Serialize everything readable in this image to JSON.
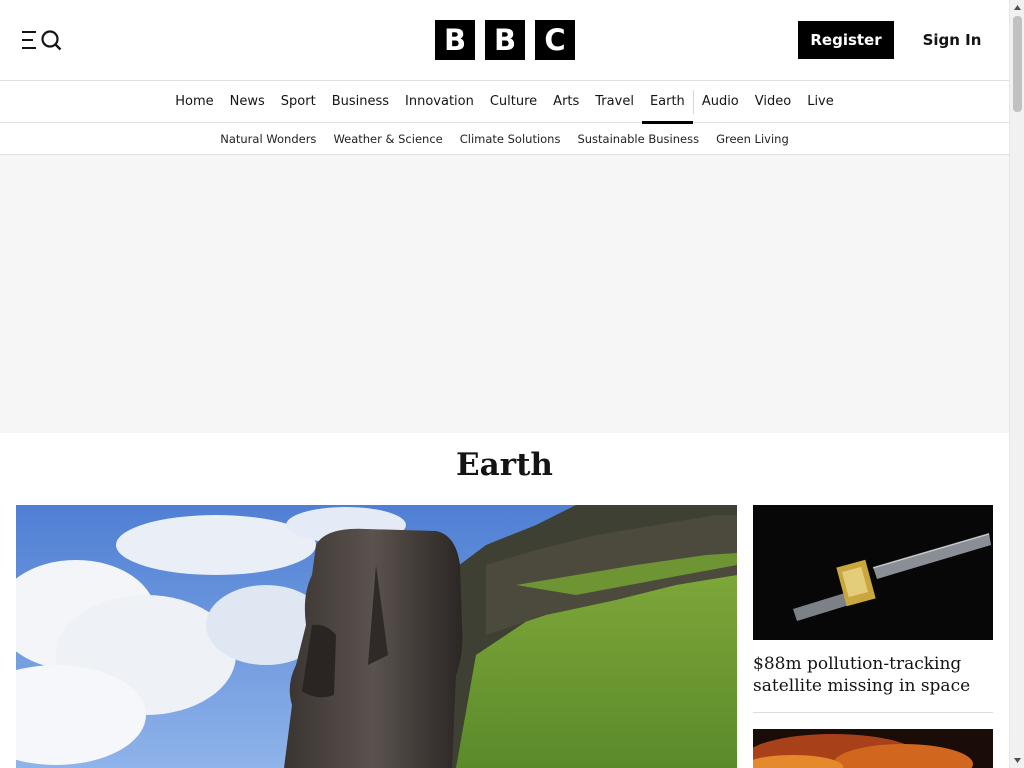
{
  "header": {
    "logo_letters": [
      "B",
      "B",
      "C"
    ],
    "register_label": "Register",
    "signin_label": "Sign In",
    "menu_icon": "menu-search-icon"
  },
  "primary_nav": {
    "items": [
      {
        "label": "Home"
      },
      {
        "label": "News"
      },
      {
        "label": "Sport"
      },
      {
        "label": "Business"
      },
      {
        "label": "Innovation"
      },
      {
        "label": "Culture"
      },
      {
        "label": "Arts"
      },
      {
        "label": "Travel"
      },
      {
        "label": "Earth"
      },
      {
        "label": "Audio"
      },
      {
        "label": "Video"
      },
      {
        "label": "Live"
      }
    ],
    "active": "Earth"
  },
  "secondary_nav": {
    "items": [
      {
        "label": "Natural Wonders"
      },
      {
        "label": "Weather & Science"
      },
      {
        "label": "Climate Solutions"
      },
      {
        "label": "Sustainable Business"
      },
      {
        "label": "Green Living"
      }
    ]
  },
  "main": {
    "section_title": "Earth",
    "side_story": {
      "headline": "$88m pollution-tracking satellite missing in space"
    }
  },
  "colors": {
    "brand": "#000000",
    "text": "#141414",
    "ad_background": "#f6f6f6",
    "divider": "#e0e0e0"
  }
}
